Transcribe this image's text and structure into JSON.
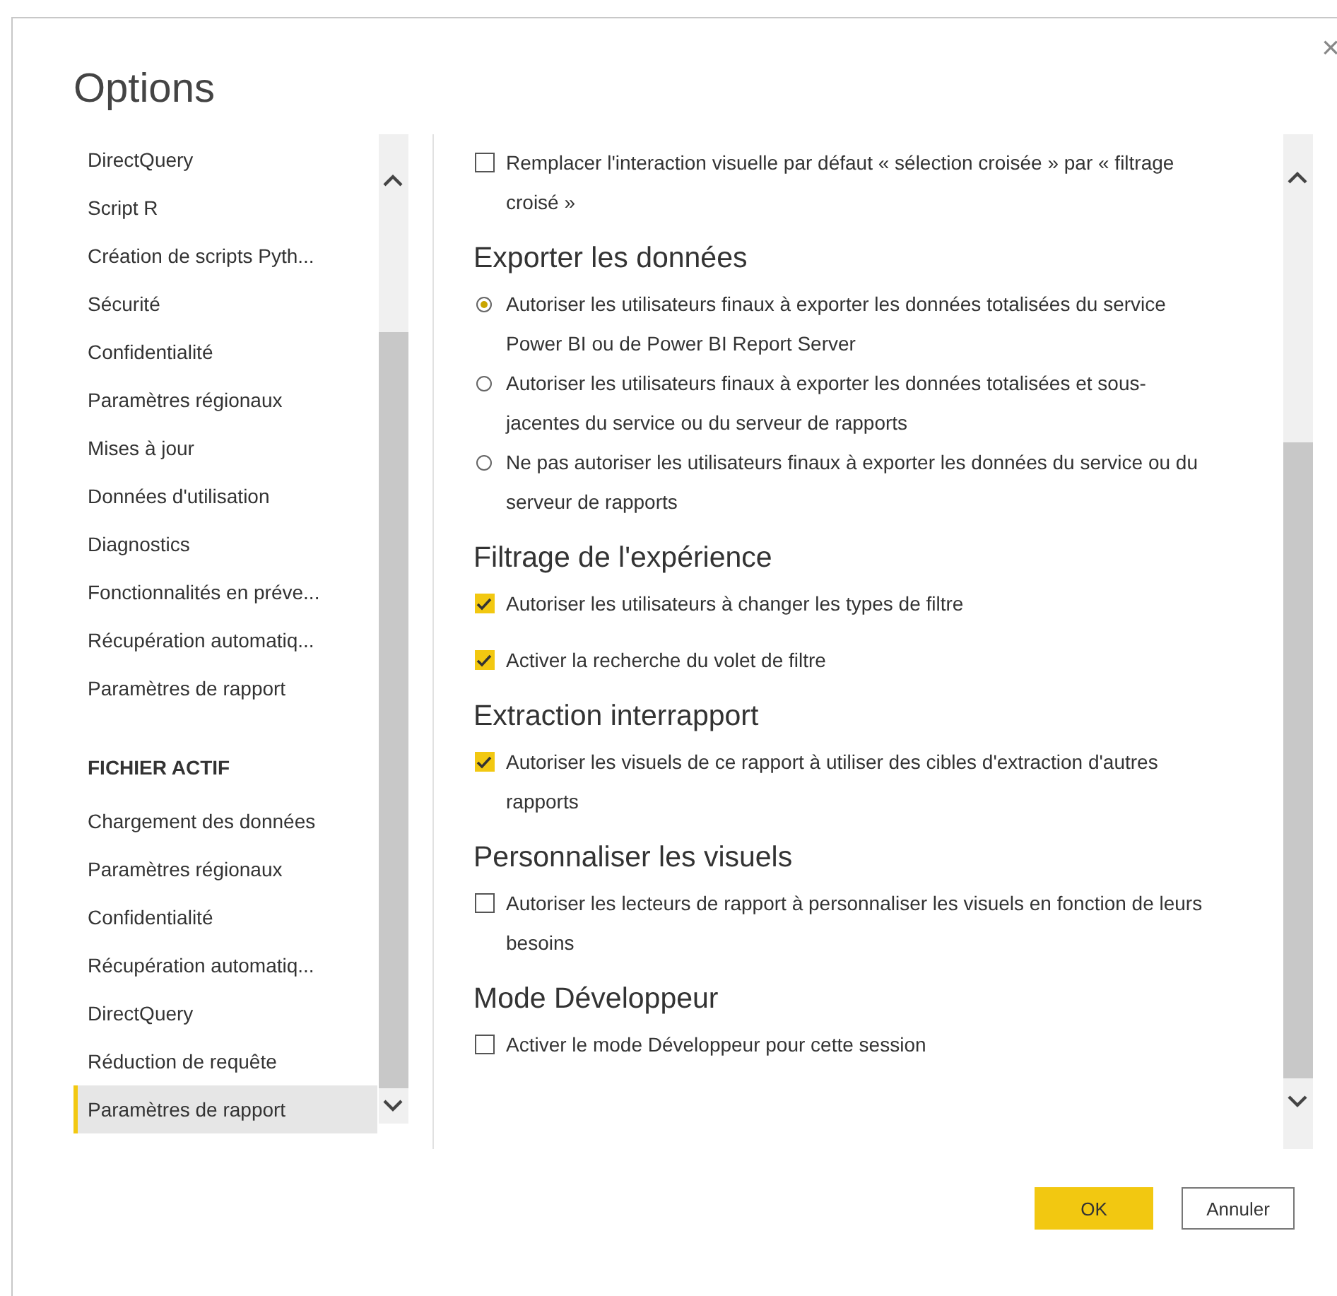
{
  "window": {
    "title": "Options",
    "close": "×"
  },
  "sidebar": {
    "sections": [
      {
        "items": [
          {
            "label": "DirectQuery",
            "selected": false
          },
          {
            "label": "Script R",
            "selected": false
          },
          {
            "label": "Création de scripts Pyth...",
            "selected": false
          },
          {
            "label": "Sécurité",
            "selected": false
          },
          {
            "label": "Confidentialité",
            "selected": false
          },
          {
            "label": "Paramètres régionaux",
            "selected": false
          },
          {
            "label": "Mises à jour",
            "selected": false
          },
          {
            "label": "Données d'utilisation",
            "selected": false
          },
          {
            "label": "Diagnostics",
            "selected": false
          },
          {
            "label": "Fonctionnalités en préve...",
            "selected": false
          },
          {
            "label": "Récupération automatiq...",
            "selected": false
          },
          {
            "label": "Paramètres de rapport",
            "selected": false
          }
        ]
      },
      {
        "header": "FICHIER ACTIF",
        "items": [
          {
            "label": "Chargement des données",
            "selected": false
          },
          {
            "label": "Paramètres régionaux",
            "selected": false
          },
          {
            "label": "Confidentialité",
            "selected": false
          },
          {
            "label": "Récupération automatiq...",
            "selected": false
          },
          {
            "label": "DirectQuery",
            "selected": false
          },
          {
            "label": "Réduction de requête",
            "selected": false
          },
          {
            "label": "Paramètres de rapport",
            "selected": true
          }
        ]
      }
    ]
  },
  "content": {
    "sections": [
      {
        "options": [
          {
            "kind": "checkbox",
            "label": "Remplacer l'interaction visuelle par défaut « sélection croisée » par « filtrage croisé »",
            "checked": false
          }
        ]
      },
      {
        "heading": "Exporter les données",
        "options": [
          {
            "kind": "radio",
            "label": "Autoriser les utilisateurs finaux à exporter les données totalisées du service Power BI ou de Power BI Report Server",
            "selected": true
          },
          {
            "kind": "radio",
            "label": "Autoriser les utilisateurs finaux à exporter les données totalisées et sous-jacentes du service ou du serveur de rapports",
            "selected": false
          },
          {
            "kind": "radio",
            "label": "Ne pas autoriser les utilisateurs finaux à exporter les données du service ou du serveur de rapports",
            "selected": false
          }
        ]
      },
      {
        "heading": "Filtrage de l'expérience",
        "options": [
          {
            "kind": "checkbox",
            "label": "Autoriser les utilisateurs à changer les types de filtre",
            "checked": true
          },
          {
            "kind": "checkbox",
            "label": "Activer la recherche du volet de filtre",
            "checked": true
          }
        ]
      },
      {
        "heading": "Extraction interrapport",
        "options": [
          {
            "kind": "checkbox",
            "label": "Autoriser les visuels de ce rapport à utiliser des cibles d'extraction d'autres rapports",
            "checked": true
          }
        ]
      },
      {
        "heading": "Personnaliser les visuels",
        "options": [
          {
            "kind": "checkbox",
            "label": "Autoriser les lecteurs de rapport à personnaliser les visuels en fonction de leurs besoins",
            "checked": false
          }
        ]
      },
      {
        "heading": "Mode Développeur",
        "options": [
          {
            "kind": "checkbox",
            "label": "Activer le mode Développeur pour cette session",
            "checked": false
          }
        ]
      }
    ]
  },
  "buttons": [
    {
      "label": "OK",
      "kind": "primary"
    },
    {
      "label": "Annuler",
      "kind": "secondary"
    }
  ]
}
